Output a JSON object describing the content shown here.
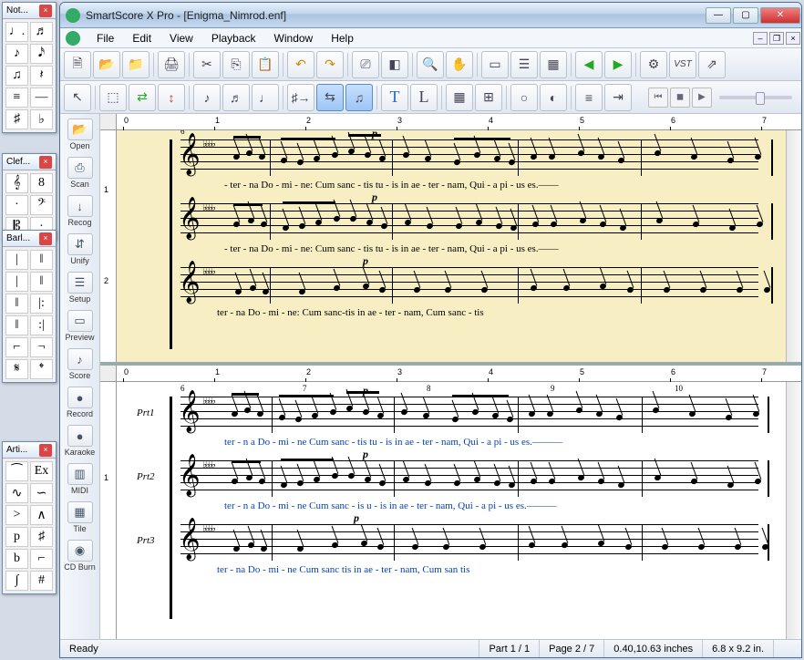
{
  "palettes": {
    "notes": {
      "title": "Not...",
      "cells": [
        "♩.",
        "♬",
        "♪",
        "𝅘𝅥𝅯",
        "♫",
        "𝄽",
        "≡",
        "—",
        "♯",
        "♭"
      ]
    },
    "clef": {
      "title": "Clef...",
      "cells": [
        "𝄞",
        "8",
        "·",
        "𝄢",
        "𝄡",
        "·"
      ]
    },
    "barl": {
      "title": "Barl...",
      "cells": [
        "|",
        "‖",
        "|",
        "‖",
        "‖",
        "|:",
        "‖",
        ":|",
        "⌐",
        "¬",
        "𝄋",
        "𝄌"
      ]
    },
    "arti": {
      "title": "Arti...",
      "cells": [
        "⁀",
        "Ex",
        "∿",
        "∽",
        ">",
        "∧",
        "p",
        "♯",
        "b",
        "⌐",
        "∫",
        "#"
      ]
    }
  },
  "window": {
    "title": "SmartScore X  Pro - [Enigma_Nimrod.enf]"
  },
  "menu": [
    "File",
    "Edit",
    "View",
    "Playback",
    "Window",
    "Help"
  ],
  "sidebar": [
    {
      "label": "Open",
      "icon": "📂"
    },
    {
      "label": "Scan",
      "icon": "⎙"
    },
    {
      "label": "Recog",
      "icon": "↓"
    },
    {
      "label": "Unify",
      "icon": "⇵"
    },
    {
      "label": "Setup",
      "icon": "☰"
    },
    {
      "label": "Preview",
      "icon": "▭"
    },
    {
      "label": "Score",
      "icon": "♪"
    },
    {
      "label": "Record",
      "icon": "●"
    },
    {
      "label": "Karaoke",
      "icon": "●"
    },
    {
      "label": "MIDI",
      "icon": "▥"
    },
    {
      "label": "Tile",
      "icon": "▦"
    },
    {
      "label": "CD Burn",
      "icon": "◉"
    }
  ],
  "ruler_top": [
    "0",
    "1",
    "2",
    "3",
    "4",
    "5",
    "6",
    "7"
  ],
  "ruler_v_top": [
    "1",
    "2"
  ],
  "ruler_v_bot": [
    "1"
  ],
  "music_top": {
    "dynamic": "p",
    "lyric_line": "- ter - na     Do - mi - ne:  Cum sanc - tis     tu - is     in ae  - ter - nam, Qui  -  a     pi - us  es.——",
    "lyric_line3": "ter - na        Do - mi - ne:   Cum   sanc-tis   in ae   -   ter  -  nam, Cum sanc  -   tis",
    "measure_start": "6"
  },
  "music_bot": {
    "parts": [
      "Prt1",
      "Prt2",
      "Prt3"
    ],
    "dynamic": "p",
    "lyric_line1": "ter - n  a     Do - mi - ne  Cum sanc - tis     tu - is     in ae - ter - nam,    Qui  -  a    pi - us  es.———",
    "lyric_line2": "ter - n  a     Do - mi - ne  Cum sanc -  is     u  - is     in ae - ter - nam,    Qui  -  a    pi - us  es.———",
    "lyric_line3": "ter - na        Do - mi - ne   Cum   sanc tis    in ae   -   ter  -  nam,   Cum   san   tis",
    "measure_numbers": [
      "6",
      "7",
      "8",
      "9",
      "10"
    ]
  },
  "status": {
    "ready": "Ready",
    "part": "Part 1 / 1",
    "page": "Page 2 / 7",
    "coords": "0.40,10.63 inches",
    "dims": "6.8 x 9.2 in."
  }
}
